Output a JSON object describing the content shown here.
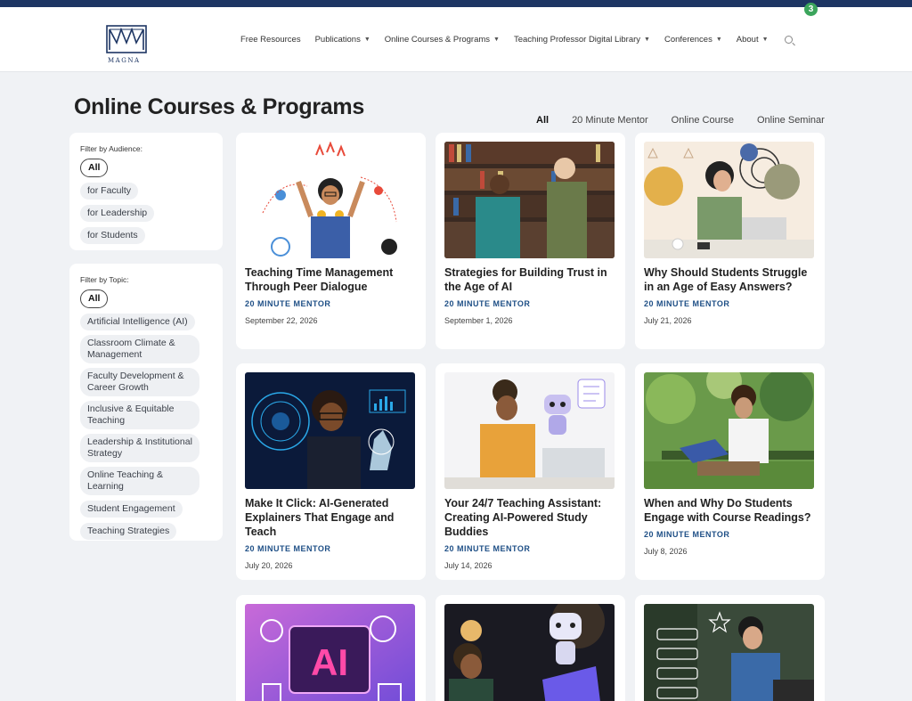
{
  "admin_bar": {
    "badge_count": "3"
  },
  "header": {
    "logo_text": "MAGNA",
    "nav": [
      {
        "label": "Free Resources",
        "dropdown": false
      },
      {
        "label": "Publications",
        "dropdown": true
      },
      {
        "label": "Online Courses & Programs",
        "dropdown": true
      },
      {
        "label": "Teaching Professor Digital Library",
        "dropdown": true
      },
      {
        "label": "Conferences",
        "dropdown": true
      },
      {
        "label": "About",
        "dropdown": true
      }
    ],
    "search_icon": "search-icon"
  },
  "page": {
    "title": "Online Courses & Programs",
    "tabs": [
      "All",
      "20 Minute Mentor",
      "Online Course",
      "Online Seminar"
    ],
    "active_tab": "All"
  },
  "audience_filter": {
    "title": "Filter by Audience:",
    "chips": [
      "All",
      "for Faculty",
      "for Leadership",
      "for Students"
    ],
    "active": "All"
  },
  "topic_filter": {
    "title": "Filter by Topic:",
    "chips": [
      "All",
      "Artificial Intelligence (AI)",
      "Classroom Climate & Management",
      "Faculty Development & Career Growth",
      "Inclusive & Equitable Teaching",
      "Leadership & Institutional Strategy",
      "Online Teaching & Learning",
      "Student Engagement",
      "Teaching Strategies"
    ],
    "active": "All"
  },
  "cards": [
    {
      "title": "Teaching Time Management Through Peer Dialogue",
      "type": "20 MINUTE MENTOR",
      "date": "September 22, 2026"
    },
    {
      "title": "Strategies for Building Trust in the Age of AI",
      "type": "20 MINUTE MENTOR",
      "date": "September 1, 2026"
    },
    {
      "title": "Why Should Students Struggle in an Age of Easy Answers?",
      "type": "20 MINUTE MENTOR",
      "date": "July 21, 2026"
    },
    {
      "title": "Make It Click: AI-Generated Explainers That Engage and Teach",
      "type": "20 MINUTE MENTOR",
      "date": "July 20, 2026"
    },
    {
      "title": "Your 24/7 Teaching Assistant: Creating AI-Powered Study Buddies",
      "type": "20 MINUTE MENTOR",
      "date": "July 14, 2026"
    },
    {
      "title": "When and Why Do Students Engage with Course Readings?",
      "type": "20 MINUTE MENTOR",
      "date": "July 8, 2026"
    },
    {
      "title": "",
      "type": "",
      "date": ""
    },
    {
      "title": "",
      "type": "",
      "date": ""
    },
    {
      "title": "",
      "type": "",
      "date": ""
    }
  ],
  "colors": {
    "accent": "#1e4f86",
    "admin_bar": "#1d3563",
    "badge": "#3ba55c"
  }
}
